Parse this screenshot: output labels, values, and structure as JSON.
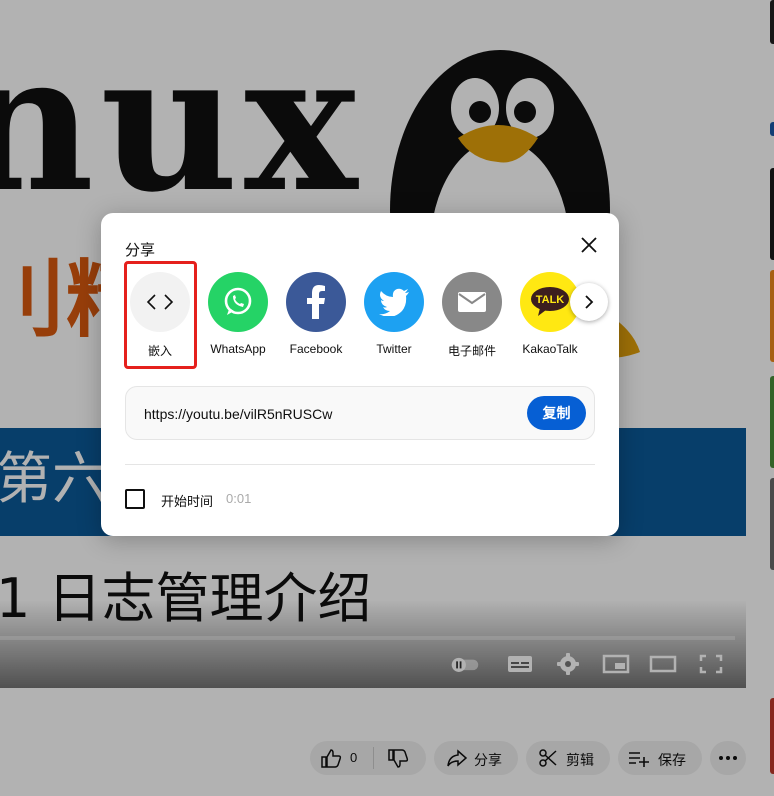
{
  "background": {
    "slide": {
      "brand_text": "nux",
      "orange_text": "刂精",
      "banner_text": "第六",
      "lesson_title": "1 日志管理介绍"
    },
    "video_controls": [
      "autoplay-toggle",
      "subtitles-icon",
      "settings-icon",
      "miniplayer-icon",
      "theater-icon",
      "fullscreen-icon"
    ],
    "actions": {
      "like_count": "0",
      "share_label": "分享",
      "clip_label": "剪辑",
      "save_label": "保存"
    }
  },
  "share_dialog": {
    "title": "分享",
    "targets": [
      {
        "label": "嵌入",
        "icon": "embed-icon",
        "color": "#f2f2f2"
      },
      {
        "label": "WhatsApp",
        "icon": "whatsapp-icon",
        "color": "#25d366"
      },
      {
        "label": "Facebook",
        "icon": "facebook-icon",
        "color": "#3b5998"
      },
      {
        "label": "Twitter",
        "icon": "twitter-icon",
        "color": "#1da1f2"
      },
      {
        "label": "电子邮件",
        "icon": "email-icon",
        "color": "#888888"
      },
      {
        "label": "KakaoTalk",
        "icon": "kakaotalk-icon",
        "color": "#ffe812"
      }
    ],
    "link": "https://youtu.be/vilR5nRUSCw",
    "copy_label": "复制",
    "start_time_label": "开始时间",
    "start_time_value": "0:01",
    "accent_color": "#065fd4",
    "highlight_color": "#e5201d"
  }
}
